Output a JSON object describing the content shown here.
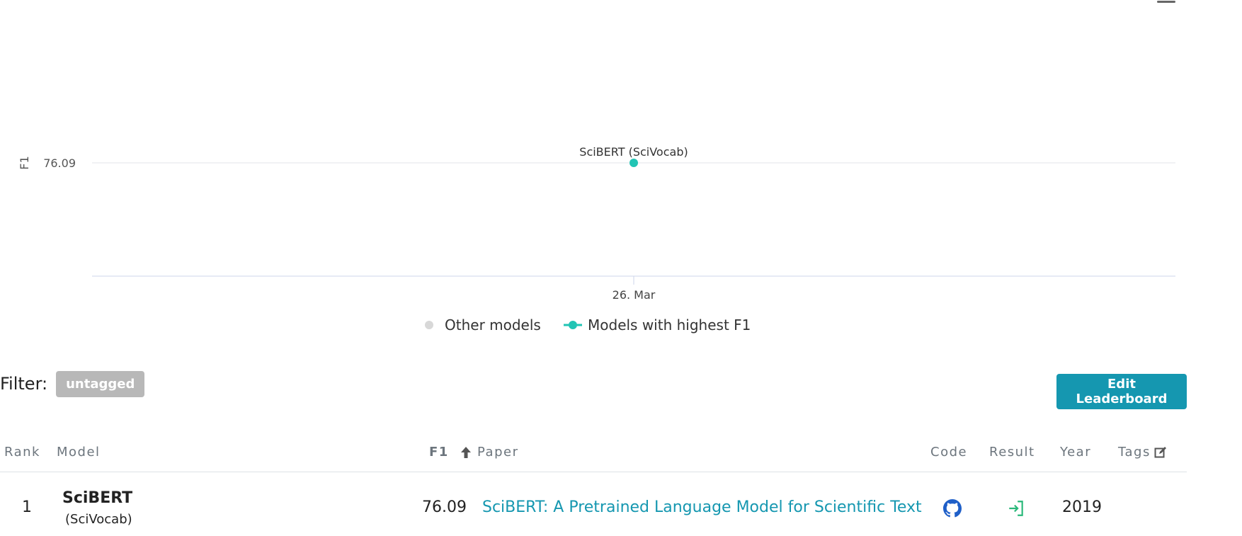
{
  "chart_data": {
    "type": "scatter",
    "title": "",
    "xlabel": "",
    "ylabel": "F1",
    "x_ticks": [
      "26. Mar"
    ],
    "y_ticks": [
      "76.09"
    ],
    "series": [
      {
        "name": "Models with highest F1",
        "color": "#21c4b4",
        "points": [
          {
            "x": "26. Mar",
            "y": 76.09,
            "label": "SciBERT (SciVocab)"
          }
        ]
      },
      {
        "name": "Other models",
        "color": "#d8d8d8",
        "points": []
      }
    ],
    "legend": [
      "Other models",
      "Models with highest F1"
    ],
    "legend_position": "bottom-center",
    "grid": true
  },
  "filter": {
    "label": "Filter:",
    "tag": "untagged"
  },
  "edit_button": "Edit Leaderboard",
  "table": {
    "headers": {
      "rank": "Rank",
      "model": "Model",
      "metric": "F1",
      "paper": "Paper",
      "code": "Code",
      "result": "Result",
      "year": "Year",
      "tags": "Tags"
    },
    "rows": [
      {
        "rank": "1",
        "model": "SciBERT",
        "model_variant": "(SciVocab)",
        "f1": "76.09",
        "paper": "SciBERT: A Pretrained Language Model for Scientific Text",
        "year": "2019"
      }
    ]
  },
  "icons": {
    "menu": "hamburger-menu-icon",
    "sort": "arrow-up-icon",
    "tags_edit": "edit-icon",
    "code": "github-icon",
    "result": "sign-in-icon"
  },
  "colors": {
    "accent": "#1597b0",
    "highlight_series": "#21c4b4",
    "other_series": "#d8d8d8",
    "tag_bg": "#b8b8b8",
    "github": "#1f5fc8",
    "result": "#2ab87a"
  }
}
